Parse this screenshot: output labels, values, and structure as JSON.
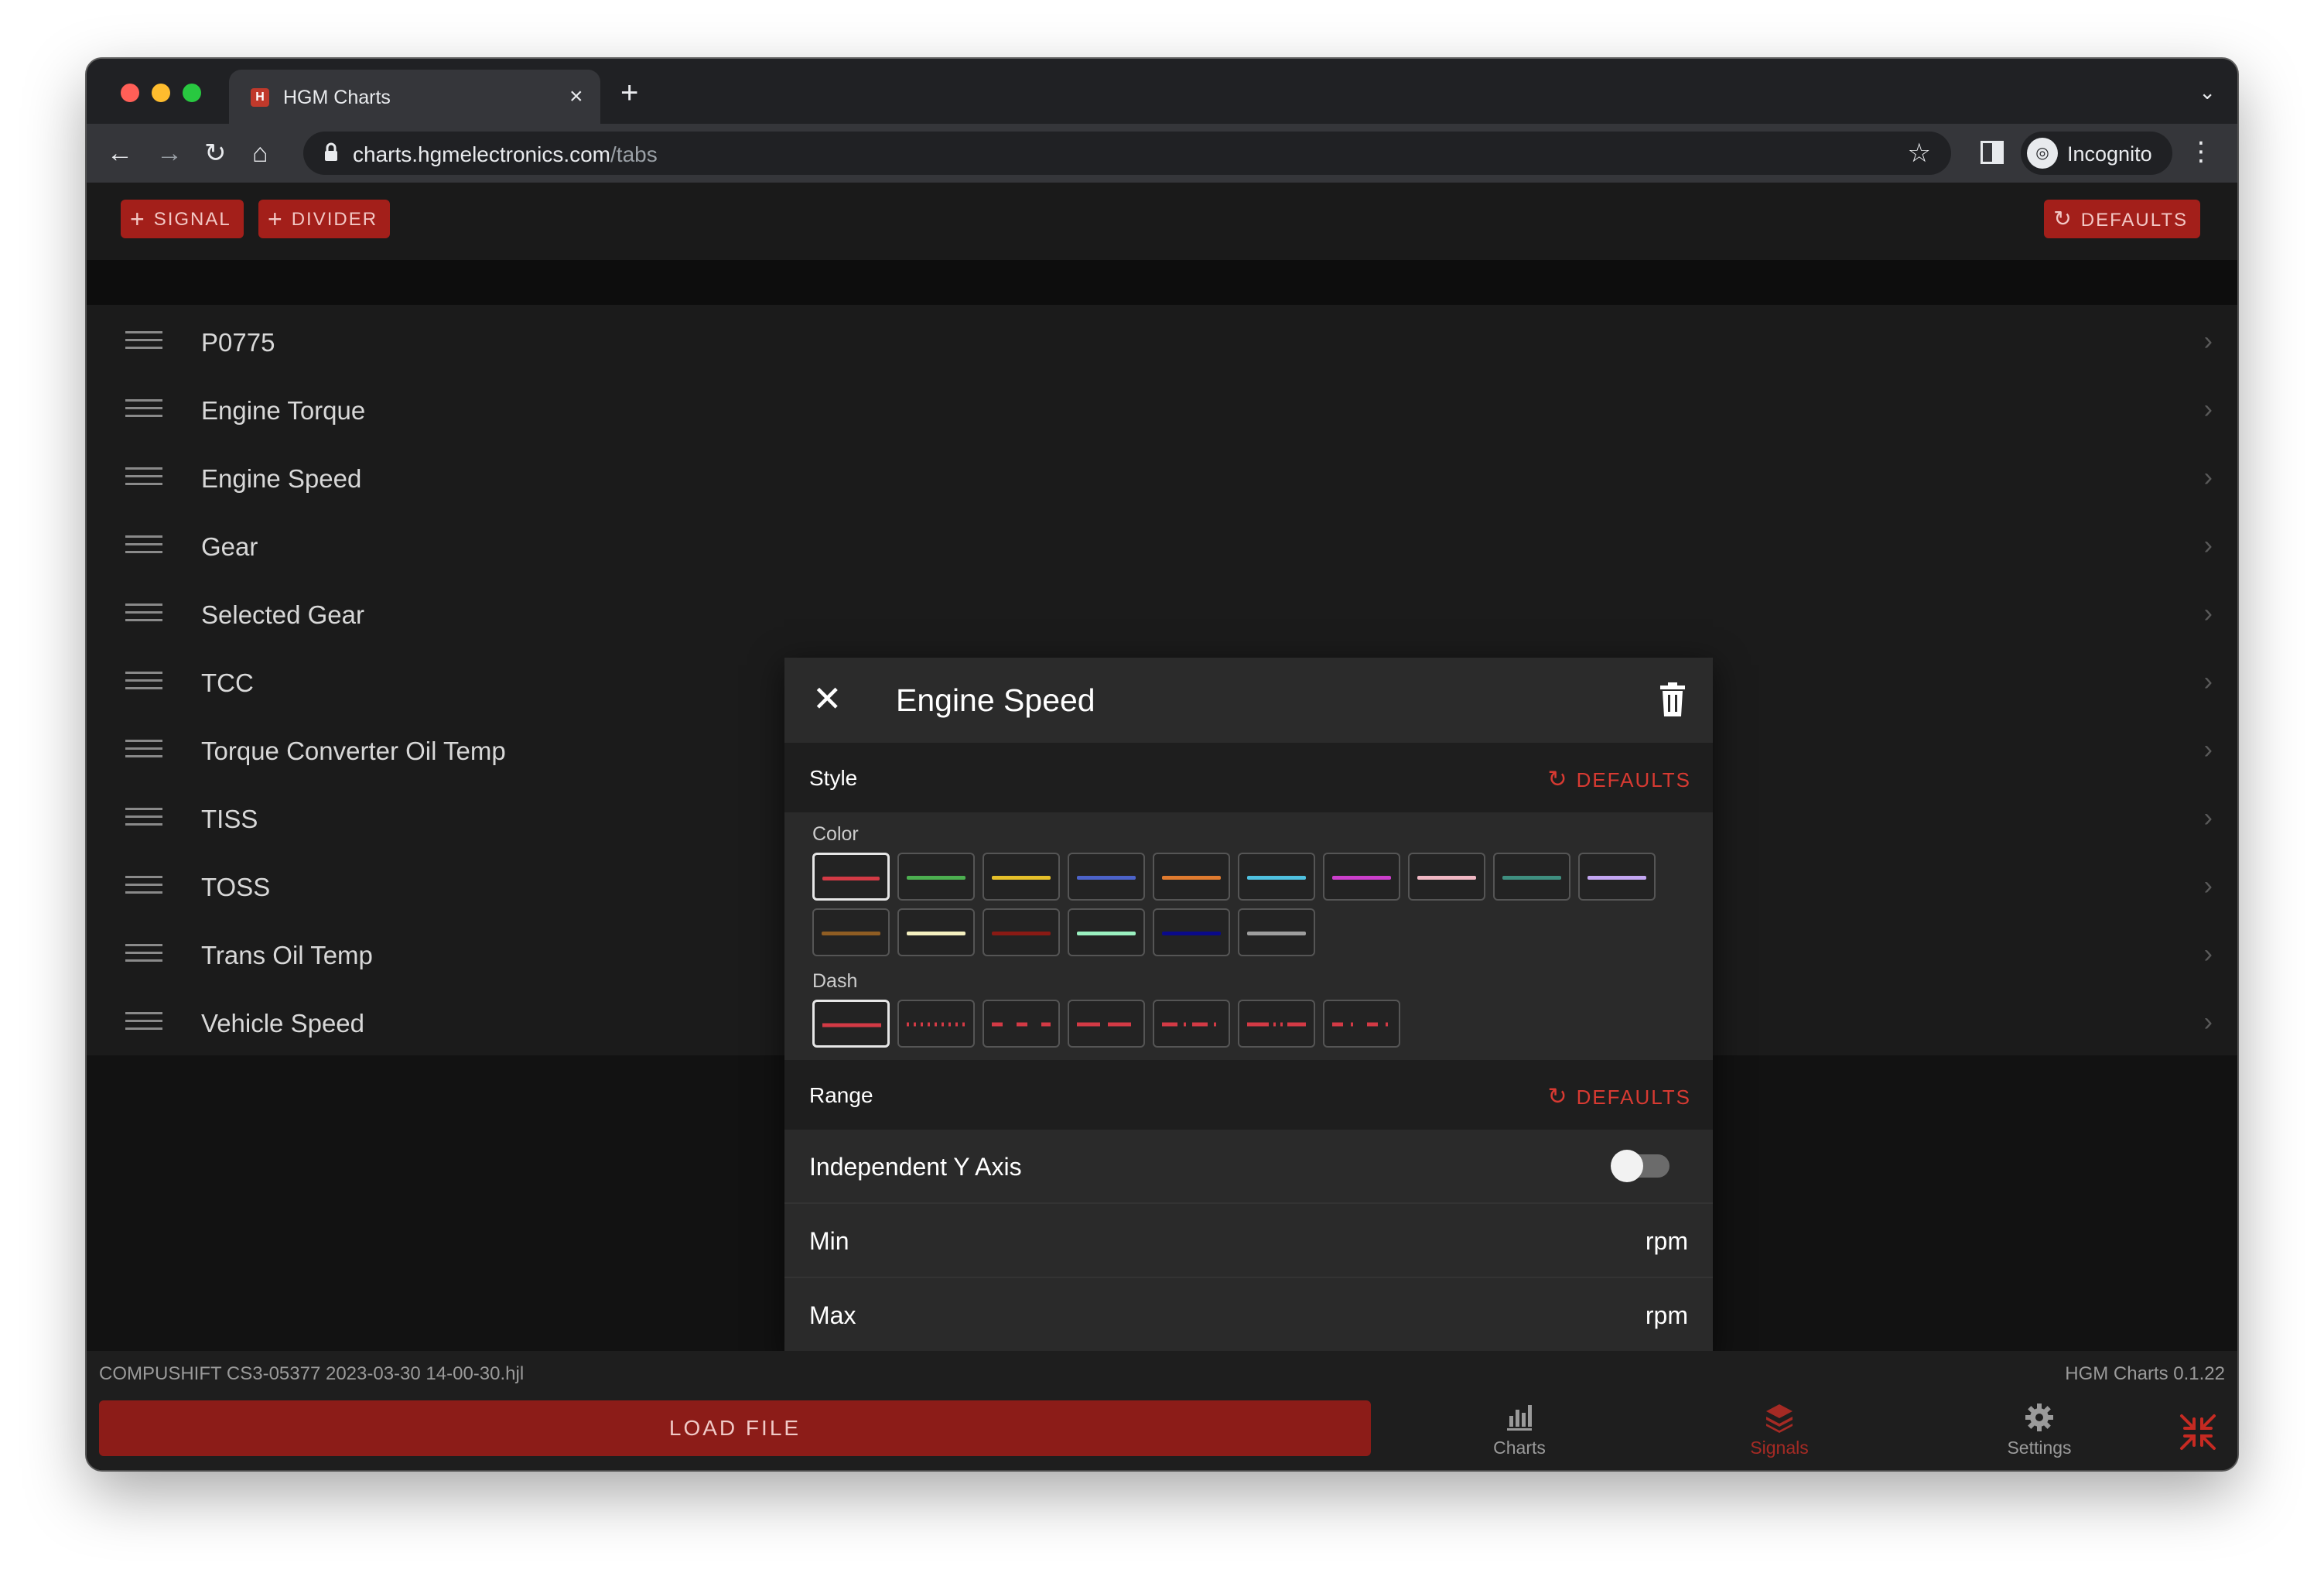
{
  "browser": {
    "tab_title": "HGM Charts",
    "tab_close": "×",
    "new_tab": "+",
    "url_host": "charts.hgmelectronics.com",
    "url_path": "/tabs",
    "incognito_label": "Incognito"
  },
  "app": {
    "add_signal_label": "SIGNAL",
    "add_divider_label": "DIVIDER",
    "defaults_label": "DEFAULTS",
    "signals": [
      {
        "label": "P0775"
      },
      {
        "label": "Engine Torque"
      },
      {
        "label": "Engine Speed"
      },
      {
        "label": "Gear"
      },
      {
        "label": "Selected Gear"
      },
      {
        "label": "TCC"
      },
      {
        "label": "Torque Converter Oil Temp"
      },
      {
        "label": "TISS"
      },
      {
        "label": "TOSS"
      },
      {
        "label": "Trans Oil Temp"
      },
      {
        "label": "Vehicle Speed"
      }
    ]
  },
  "modal": {
    "title": "Engine Speed",
    "style_label": "Style",
    "style_defaults_label": "DEFAULTS",
    "color_label": "Color",
    "colors": [
      "#d33a45",
      "#4caf50",
      "#e6c02a",
      "#4c63c9",
      "#e07b2f",
      "#4fc1e0",
      "#cc3fcc",
      "#f0b7c3",
      "#3f8f80",
      "#c3a6f2",
      "#8f5d23",
      "#f5f0c0",
      "#8a1a14",
      "#9af0c0",
      "#0a0a8a",
      "#9e9e9e"
    ],
    "selected_color_index": 0,
    "dash_label": "Dash",
    "dash_patterns": [
      "solid",
      "dotted",
      "dashed",
      "long-dash",
      "dash-dot",
      "long-dash-dot-dot",
      "dash-dot-sparse"
    ],
    "selected_dash_index": 0,
    "range_label": "Range",
    "range_defaults_label": "DEFAULTS",
    "independent_y_label": "Independent Y Axis",
    "independent_y_on": false,
    "min_label": "Min",
    "min_unit": "rpm",
    "max_label": "Max",
    "max_unit": "rpm"
  },
  "footer": {
    "file_name": "COMPUSHIFT CS3-05377 2023-03-30 14-00-30.hjl",
    "version": "HGM Charts 0.1.22",
    "load_file_label": "LOAD FILE",
    "nav": [
      {
        "label": "Charts",
        "icon": "bar-chart-icon",
        "active": false
      },
      {
        "label": "Signals",
        "icon": "layers-icon",
        "active": true
      },
      {
        "label": "Settings",
        "icon": "gear-icon",
        "active": false
      }
    ]
  },
  "colors": {
    "accent": "#a31f1a",
    "accent_text": "#d83a32"
  }
}
